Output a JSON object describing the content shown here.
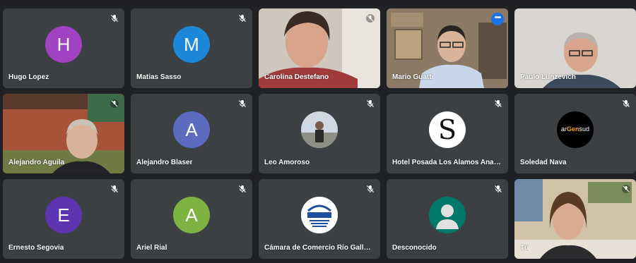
{
  "participants": [
    {
      "name": "Hugo Lopez",
      "initial": "H",
      "color": "#a142c2"
    },
    {
      "name": "Matias Sasso",
      "initial": "M",
      "color": "#1e88d8"
    },
    {
      "name": "Carolina Destefano"
    },
    {
      "name": "Mario Guatti"
    },
    {
      "name": "Paulo Lunzevich"
    },
    {
      "name": "Alejandro Aguila"
    },
    {
      "name": "Alejandro Blaser",
      "initial": "A",
      "color": "#5c6bc0"
    },
    {
      "name": "Leo Amoroso"
    },
    {
      "name": "Hotel Posada Los Alamos Ana Vell..."
    },
    {
      "name": "Soledad Nava",
      "logo": "arGensud"
    },
    {
      "name": "Ernesto Segovia",
      "initial": "E",
      "color": "#5e35b1"
    },
    {
      "name": "Ariel Rial",
      "initial": "A",
      "color": "#7cb342"
    },
    {
      "name": "Cámara de Comercio Río Gallegos",
      "logo": "C.C.I.A.R.G."
    },
    {
      "name": "Desconocido",
      "color": "#00796b"
    },
    {
      "name": "Tú"
    }
  ],
  "logo_letter": "S",
  "argensud": {
    "pre": "ar",
    "mid": "Gen",
    "post": "sud"
  }
}
